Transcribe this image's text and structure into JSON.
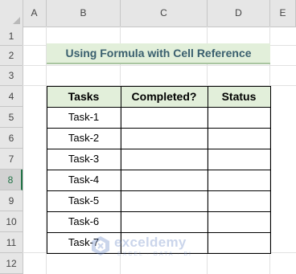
{
  "columns": [
    "A",
    "B",
    "C",
    "D",
    "E"
  ],
  "rows": [
    "1",
    "2",
    "3",
    "4",
    "5",
    "6",
    "7",
    "8",
    "9",
    "10",
    "11",
    "12"
  ],
  "title": "Using Formula with Cell Reference",
  "table": {
    "headers": [
      "Tasks",
      "Completed?",
      "Status"
    ],
    "tasks": [
      "Task-1",
      "Task-2",
      "Task-3",
      "Task-4",
      "Task-5",
      "Task-6",
      "Task-7"
    ]
  },
  "watermark": {
    "name": "exceldemy",
    "tagline": "EXCEL · DATA · BI"
  },
  "colors": {
    "header_fill": "#e2efda",
    "title_text": "#3a5f6e",
    "active_row": "#217346"
  }
}
